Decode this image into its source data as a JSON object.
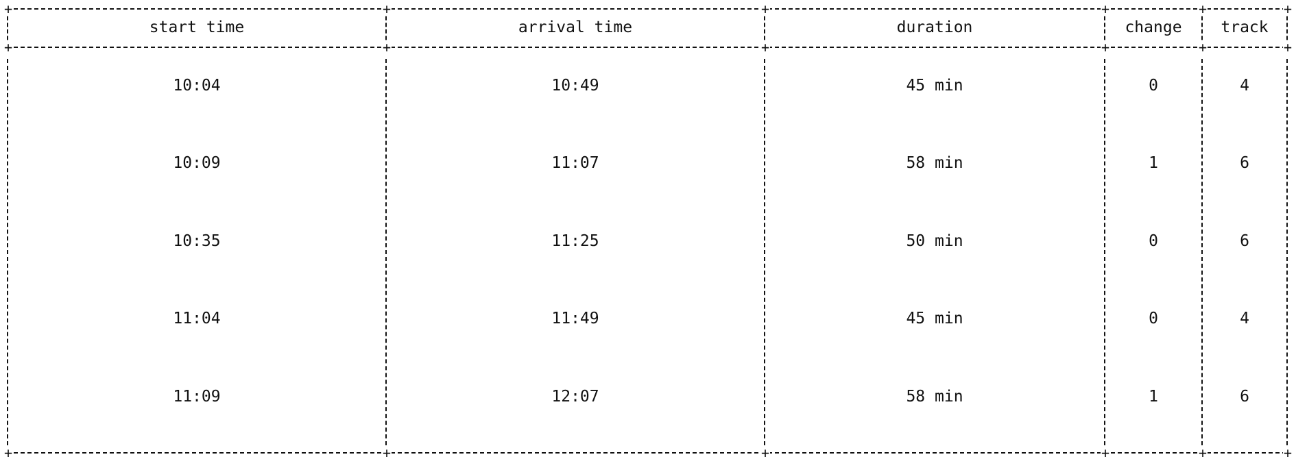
{
  "table": {
    "columns": [
      "start time",
      "arrival time",
      "duration",
      "change",
      "track"
    ],
    "rows": [
      [
        "10:04",
        "10:49",
        "45 min",
        "0",
        "4"
      ],
      [
        "10:09",
        "11:07",
        "58 min",
        "1",
        "6"
      ],
      [
        "10:35",
        "11:25",
        "50 min",
        "0",
        "6"
      ],
      [
        "11:04",
        "11:49",
        "45 min",
        "0",
        "4"
      ],
      [
        "11:09",
        "12:07",
        "58 min",
        "1",
        "6"
      ]
    ]
  },
  "colors": {
    "text": "#111111",
    "background": "#ffffff"
  }
}
